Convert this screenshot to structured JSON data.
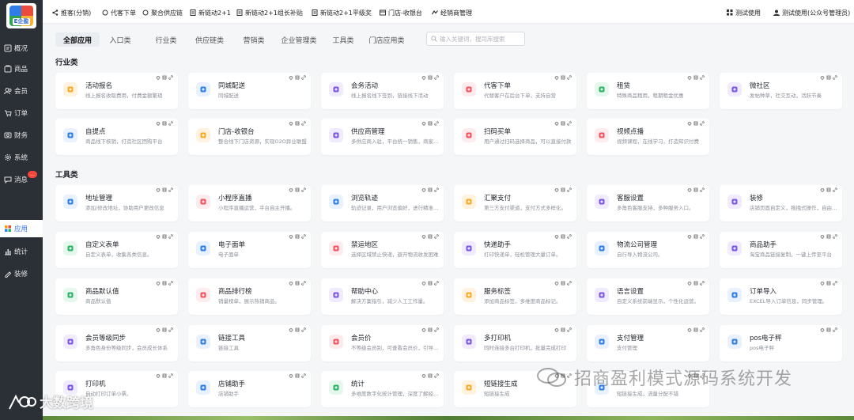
{
  "logo": {
    "text": "E企盈"
  },
  "sidebar": {
    "items": [
      {
        "label": "概况",
        "icon": "overview-icon"
      },
      {
        "label": "商品",
        "icon": "goods-icon"
      },
      {
        "label": "会员",
        "icon": "members-icon"
      },
      {
        "label": "订单",
        "icon": "orders-icon"
      },
      {
        "label": "财务",
        "icon": "finance-icon"
      },
      {
        "label": "系统",
        "icon": "settings-icon"
      },
      {
        "label": "消息",
        "icon": "message-icon",
        "badge": "…"
      },
      {
        "label": "应用",
        "icon": "apps-icon",
        "active": true
      },
      {
        "label": "统计",
        "icon": "chart-icon"
      },
      {
        "label": "装修",
        "icon": "decorate-icon"
      }
    ]
  },
  "topbar": {
    "items": [
      "推客(分销)",
      "代客下单",
      "聚合供应链",
      "新链动2+1",
      "新链动2+1组长补贴",
      "新链动2+1平级奖",
      "门店-收银台",
      "经销商管理"
    ],
    "store": "测试使用",
    "user": "测试使用(公众号管理员)"
  },
  "tabs": [
    "全部应用",
    "入口类",
    "行业类",
    "供应链类",
    "营销类",
    "企业管理类",
    "工具类",
    "门店应用类"
  ],
  "search": {
    "placeholder": "输入关键词，搜司库搜索"
  },
  "sections": {
    "industry": {
      "title": "行业类",
      "cards": [
        {
          "title": "活动报名",
          "desc": "线上报名收取费用，付费金额繁琐",
          "color": "#f7a823",
          "bg": "#fff3e0"
        },
        {
          "title": "同城配送",
          "desc": "同城配送",
          "color": "#2f7ee8",
          "bg": "#e8f1fd"
        },
        {
          "title": "会务活动",
          "desc": "线上报名线下签到，链接线下活动",
          "color": "#7b55e6",
          "bg": "#f0ebfd"
        },
        {
          "title": "代客下单",
          "desc": "代替客户在后台下单，支持自营",
          "color": "#f2515e",
          "bg": "#fdecee"
        },
        {
          "title": "租赁",
          "desc": "特殊商品租用，租期租金优惠",
          "color": "#28b463",
          "bg": "#e6f7ee"
        },
        {
          "title": "微社区",
          "desc": "发帖种草，社交互动，活跃节奏",
          "color": "#7b55e6",
          "bg": "#f0ebfd"
        },
        {
          "title": "自提点",
          "desc": "商品线下核销，打造社区团购平台",
          "color": "#2f7ee8",
          "bg": "#e8f1fd"
        },
        {
          "title": "门店-收银台",
          "desc": "整合线下门店资源，实现O2O异业联盟",
          "color": "#f7a823",
          "bg": "#fff3e0"
        },
        {
          "title": "供应商管理",
          "desc": "多供应商入驻，平台统一销售，商家自营",
          "color": "#7b55e6",
          "bg": "#f0ebfd"
        },
        {
          "title": "扫码买单",
          "desc": "用户通过扫码选择商品，可以直接付款",
          "color": "#f2515e",
          "bg": "#fdecee"
        },
        {
          "title": "视频点播",
          "desc": "视频课程，在线学习，打造知识付费",
          "color": "#f2515e",
          "bg": "#fdecee"
        }
      ]
    },
    "tools": {
      "title": "工具类",
      "cards": [
        {
          "title": "地址管理",
          "desc": "添加/修改地址，协助用户更改信息",
          "color": "#2f7ee8",
          "bg": "#e8f1fd"
        },
        {
          "title": "小程序直播",
          "desc": "小程序直播运营，平台自主开播。",
          "color": "#f2515e",
          "bg": "#fdecee"
        },
        {
          "title": "浏览轨迹",
          "desc": "轨迹记录，用户浏览偏好，进行精准营销",
          "color": "#2f7ee8",
          "bg": "#e8f1fd"
        },
        {
          "title": "汇聚支付",
          "desc": "第三方支付渠道，支付方式多样化。",
          "color": "#f7a823",
          "bg": "#fff3e0"
        },
        {
          "title": "客服设置",
          "desc": "多角色客服支持，多种服务入口。",
          "color": "#7b55e6",
          "bg": "#f0ebfd"
        },
        {
          "title": "装修",
          "desc": "店铺页面自定义，拖拽式操作，自由搭建",
          "color": "#7b55e6",
          "bg": "#f0ebfd"
        },
        {
          "title": "自定义表单",
          "desc": "自定义表单，收集各类信息。",
          "color": "#28b463",
          "bg": "#e6f7ee"
        },
        {
          "title": "电子面单",
          "desc": "电子面单",
          "color": "#2f7ee8",
          "bg": "#e8f1fd"
        },
        {
          "title": "禁运地区",
          "desc": "选择区域禁止快递，避开物流收发困难",
          "color": "#f2515e",
          "bg": "#fdecee"
        },
        {
          "title": "快递助手",
          "desc": "打印快递单，轻松管理大量订单。",
          "color": "#7b55e6",
          "bg": "#f0ebfd"
        },
        {
          "title": "物流公司管理",
          "desc": "自行导入物流公司。",
          "color": "#2f7ee8",
          "bg": "#e8f1fd"
        },
        {
          "title": "商品助手",
          "desc": "淘宝商品链接复制，一键上传至平台",
          "color": "#7b55e6",
          "bg": "#f0ebfd"
        },
        {
          "title": "商品默认值",
          "desc": "商品默认值",
          "color": "#28b463",
          "bg": "#e6f7ee"
        },
        {
          "title": "商品排行榜",
          "desc": "销量榜单，展示热销商品。",
          "color": "#f2515e",
          "bg": "#fdecee"
        },
        {
          "title": "帮助中心",
          "desc": "解决方案指引，减少人工工作量。",
          "color": "#7b55e6",
          "bg": "#f0ebfd"
        },
        {
          "title": "服务标签",
          "desc": "添加商品标签，多维度商品标记。",
          "color": "#f7a823",
          "bg": "#fff3e0"
        },
        {
          "title": "语言设置",
          "desc": "自定义系统前端显示，个性化运营。",
          "color": "#7b55e6",
          "bg": "#f0ebfd"
        },
        {
          "title": "订单导入",
          "desc": "EXCEL导入订单信息，同步管理。",
          "color": "#2f7ee8",
          "bg": "#e8f1fd"
        },
        {
          "title": "会员等级同步",
          "desc": "多角色身份等级同步，会员成长体系",
          "color": "#7b55e6",
          "bg": "#f0ebfd"
        },
        {
          "title": "链接工具",
          "desc": "链接工具",
          "color": "#2f7ee8",
          "bg": "#e8f1fd"
        },
        {
          "title": "会员价",
          "desc": "不等级会员别，可查看会员价，引导消费",
          "color": "#f2515e",
          "bg": "#fdecee"
        },
        {
          "title": "多打印机",
          "desc": "同时连接多台打印机，批量完成打印",
          "color": "#7b55e6",
          "bg": "#f0ebfd"
        },
        {
          "title": "支付管理",
          "desc": "支付管理",
          "color": "#2f7ee8",
          "bg": "#e8f1fd"
        },
        {
          "title": "pos电子秤",
          "desc": "pos电子秤",
          "color": "#2f7ee8",
          "bg": "#e8f1fd"
        },
        {
          "title": "打印机",
          "desc": "自动打印订单小票。",
          "color": "#7b55e6",
          "bg": "#f0ebfd"
        },
        {
          "title": "店铺助手",
          "desc": "店铺助手",
          "color": "#2f7ee8",
          "bg": "#e8f1fd"
        },
        {
          "title": "统计",
          "desc": "多维度数字化统计管理，深度了解经营情况",
          "color": "#28b463",
          "bg": "#e6f7ee"
        },
        {
          "title": "短链接生成",
          "desc": "短链接生成",
          "color": "#f7a823",
          "bg": "#fff3e0"
        },
        {
          "title": "",
          "desc": "短链接生成，流量分配不错",
          "color": "#2f7ee8",
          "bg": "#e8f1fd"
        }
      ]
    }
  },
  "watermarks": {
    "right": "招商盈利模式源码系统开发",
    "left": "大数跨境"
  }
}
